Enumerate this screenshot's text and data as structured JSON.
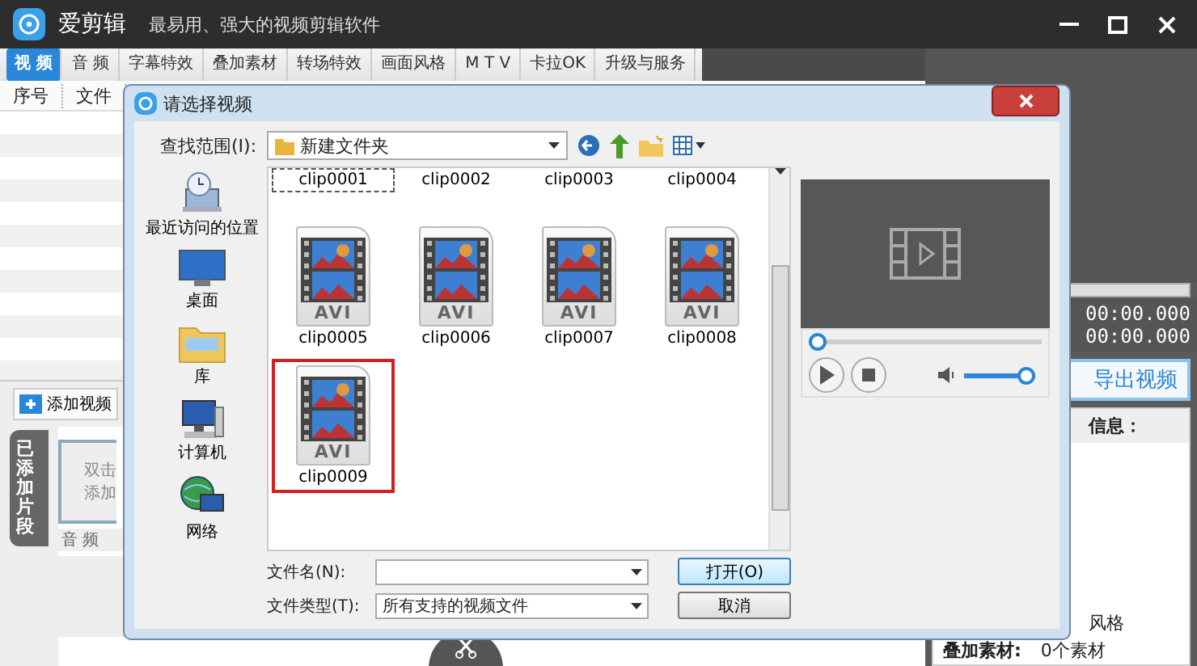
{
  "app": {
    "title": "爱剪辑",
    "slogan": "最易用、强大的视频剪辑软件"
  },
  "tabs": [
    {
      "label": "视 频",
      "selected": true
    },
    {
      "label": "音 频",
      "selected": false
    },
    {
      "label": "字幕特效",
      "selected": false
    },
    {
      "label": "叠加素材",
      "selected": false
    },
    {
      "label": "转场特效",
      "selected": false
    },
    {
      "label": "画面风格",
      "selected": false
    },
    {
      "label": "M T V",
      "selected": false
    },
    {
      "label": "卡拉OK",
      "selected": false
    },
    {
      "label": "升级与服务",
      "selected": false
    }
  ],
  "clip_list": {
    "columns": [
      "序号",
      "文件"
    ]
  },
  "add_video_button": "添加视频",
  "side_tab": "已添加片段",
  "clip_slot": {
    "lines": [
      "双击",
      "添加"
    ]
  },
  "audio_track_label": "音 频",
  "preview": {
    "times": [
      "00:00.000",
      "00:00.000"
    ]
  },
  "export_button": "导出视频",
  "info": {
    "title": "信息：",
    "style_text": "风格",
    "overlay_label": "叠加素材:",
    "overlay_value": "0个素材"
  },
  "dialog": {
    "title": "请选择视频",
    "look_in_label": "查找范围(I):",
    "look_in_value": "新建文件夹",
    "places": [
      {
        "label": "最近访问的位置",
        "kind": "recent"
      },
      {
        "label": "桌面",
        "kind": "desktop"
      },
      {
        "label": "库",
        "kind": "library"
      },
      {
        "label": "计算机",
        "kind": "computer"
      },
      {
        "label": "网络",
        "kind": "network"
      }
    ],
    "files": [
      {
        "name": "clip0001",
        "kind": "cut",
        "focused": true,
        "selected": false
      },
      {
        "name": "clip0002",
        "kind": "cut",
        "focused": false,
        "selected": false
      },
      {
        "name": "clip0003",
        "kind": "cut",
        "focused": false,
        "selected": false
      },
      {
        "name": "clip0004",
        "kind": "cut",
        "focused": false,
        "selected": false
      },
      {
        "name": "clip0005",
        "kind": "avi",
        "type_label": "AVI",
        "focused": false,
        "selected": false
      },
      {
        "name": "clip0006",
        "kind": "avi",
        "type_label": "AVI",
        "focused": false,
        "selected": false
      },
      {
        "name": "clip0007",
        "kind": "avi",
        "type_label": "AVI",
        "focused": false,
        "selected": false
      },
      {
        "name": "clip0008",
        "kind": "avi",
        "type_label": "AVI",
        "focused": false,
        "selected": false
      },
      {
        "name": "clip0009",
        "kind": "avi",
        "type_label": "AVI",
        "focused": false,
        "selected": true
      }
    ],
    "file_name_label": "文件名(N):",
    "file_type_label": "文件类型(T):",
    "file_type_value": "所有支持的视频文件",
    "open_button": "打开(O)",
    "cancel_button": "取消",
    "player": {
      "seek": {
        "level": 0
      },
      "volume": {
        "level": 1
      }
    }
  }
}
